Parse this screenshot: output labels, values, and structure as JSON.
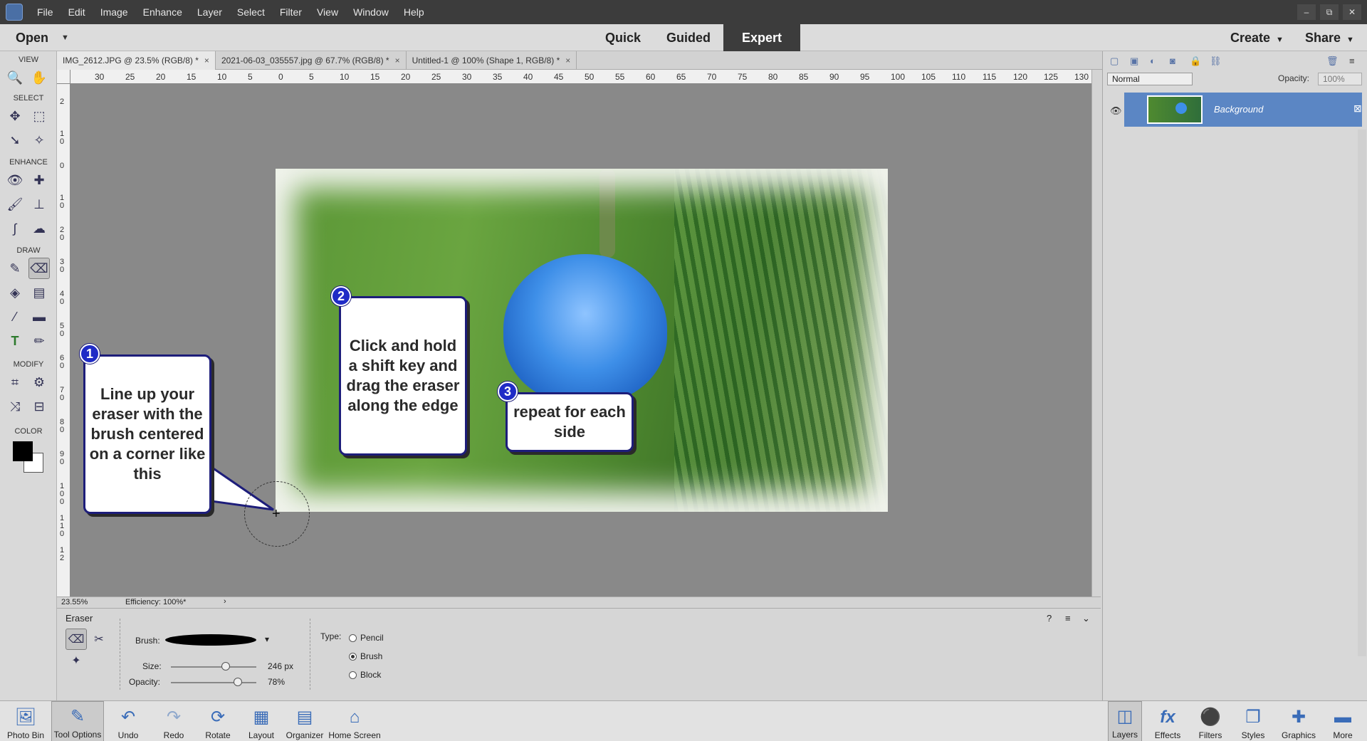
{
  "menubar": {
    "items": [
      "File",
      "Edit",
      "Image",
      "Enhance",
      "Layer",
      "Select",
      "Filter",
      "View",
      "Window",
      "Help"
    ],
    "win_ctrls": [
      "–",
      "⧉",
      "✕"
    ]
  },
  "modebar": {
    "open": "Open",
    "tabs": [
      "Quick",
      "Guided",
      "Expert"
    ],
    "active_tab": "Expert",
    "create": "Create",
    "share": "Share"
  },
  "toolbox": {
    "view": "VIEW",
    "select": "SELECT",
    "enhance": "ENHANCE",
    "draw": "DRAW",
    "modify": "MODIFY",
    "color": "COLOR",
    "text_tool": "T"
  },
  "doc_tabs": [
    "IMG_2612.JPG @ 23.5% (RGB/8) *",
    "2021-06-03_035557.jpg @ 67.7% (RGB/8) *",
    "Untitled-1 @ 100% (Shape 1, RGB/8) *"
  ],
  "ruler_top": [
    "30",
    "25",
    "20",
    "15",
    "10",
    "5",
    "0",
    "5",
    "10",
    "15",
    "20",
    "25",
    "30",
    "35",
    "40",
    "45",
    "50",
    "55",
    "60",
    "65",
    "70",
    "75",
    "80",
    "85",
    "90",
    "95",
    "100",
    "105",
    "110",
    "115",
    "120",
    "125",
    "130"
  ],
  "ruler_left": [
    "2",
    "1 0",
    "0",
    "1 0",
    "2 0",
    "3 0",
    "4 0",
    "5 0",
    "6 0",
    "7 0",
    "8 0",
    "9 0",
    "1 0 0",
    "1 1 0",
    "1 2"
  ],
  "status": {
    "zoom": "23.55%",
    "efficiency": "Efficiency: 100%*"
  },
  "callouts": {
    "c1": {
      "num": "1",
      "text": "Line up your eraser with the brush centered on a corner like this"
    },
    "c2": {
      "num": "2",
      "text": "Click and hold a shift key and drag the eraser along the edge"
    },
    "c3": {
      "num": "3",
      "text": "repeat for each side"
    }
  },
  "layers": {
    "blend": "Normal",
    "opacity_label": "Opacity:",
    "opacity": "100%",
    "layer_name": "Background"
  },
  "tool_options": {
    "title": "Eraser",
    "brush_label": "Brush:",
    "size_label": "Size:",
    "size_value": "246 px",
    "size_fraction": 0.64,
    "opacity_label": "Opacity:",
    "opacity_value": "78%",
    "opacity_fraction": 0.78,
    "type_label": "Type:",
    "types": [
      "Pencil",
      "Brush",
      "Block"
    ],
    "selected_type": "Brush"
  },
  "taskbar": {
    "left": [
      "Photo Bin",
      "Tool Options",
      "Undo",
      "Redo",
      "Rotate",
      "Layout",
      "Organizer",
      "Home Screen"
    ],
    "right": [
      "Layers",
      "Effects",
      "Filters",
      "Styles",
      "Graphics",
      "More"
    ]
  },
  "colors": {
    "accent": "#5b86c4",
    "menubar": "#3c3c3c",
    "callout_border": "#1d1d7a",
    "badge": "#1f2bc6"
  }
}
